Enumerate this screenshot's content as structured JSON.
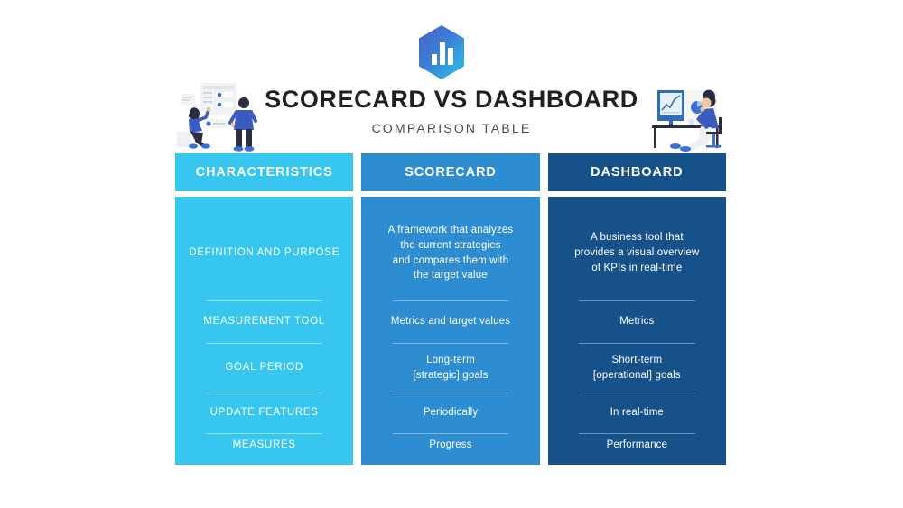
{
  "header": {
    "title": "SCORECARD VS DASHBOARD",
    "subtitle": "COMPARISON TABLE",
    "logo_icon": "bar-chart-hexagon-logo"
  },
  "illustrations": {
    "left": "people-presenting-dashboard-illustration",
    "right": "person-at-desk-with-monitor-illustration"
  },
  "colors": {
    "characteristics": "#36c6f0",
    "scorecard": "#2e8cd0",
    "dashboard": "#17518a",
    "title_text": "#231f20",
    "subtitle_text": "#4a4a4a",
    "cell_text": "#ffffff"
  },
  "table": {
    "columns": [
      {
        "key": "characteristics",
        "label": "CHARACTERISTICS"
      },
      {
        "key": "scorecard",
        "label": "SCORECARD"
      },
      {
        "key": "dashboard",
        "label": "DASHBOARD"
      }
    ],
    "rows": [
      {
        "characteristic": "DEFINITION AND PURPOSE",
        "scorecard": "A framework that analyzes\nthe current strategies\nand compares them with\nthe target value",
        "dashboard": "A business tool that\nprovides a visual overview\nof KPIs in real-time"
      },
      {
        "characteristic": "MEASUREMENT TOOL",
        "scorecard": "Metrics and target values",
        "dashboard": "Metrics"
      },
      {
        "characteristic": "GOAL PERIOD",
        "scorecard": "Long-term\n[strategic] goals",
        "dashboard": "Short-term\n[operational] goals"
      },
      {
        "characteristic": "UPDATE FEATURES",
        "scorecard": "Periodically",
        "dashboard": "In real-time"
      },
      {
        "characteristic": "MEASURES",
        "scorecard": "Progress",
        "dashboard": "Performance"
      }
    ]
  }
}
